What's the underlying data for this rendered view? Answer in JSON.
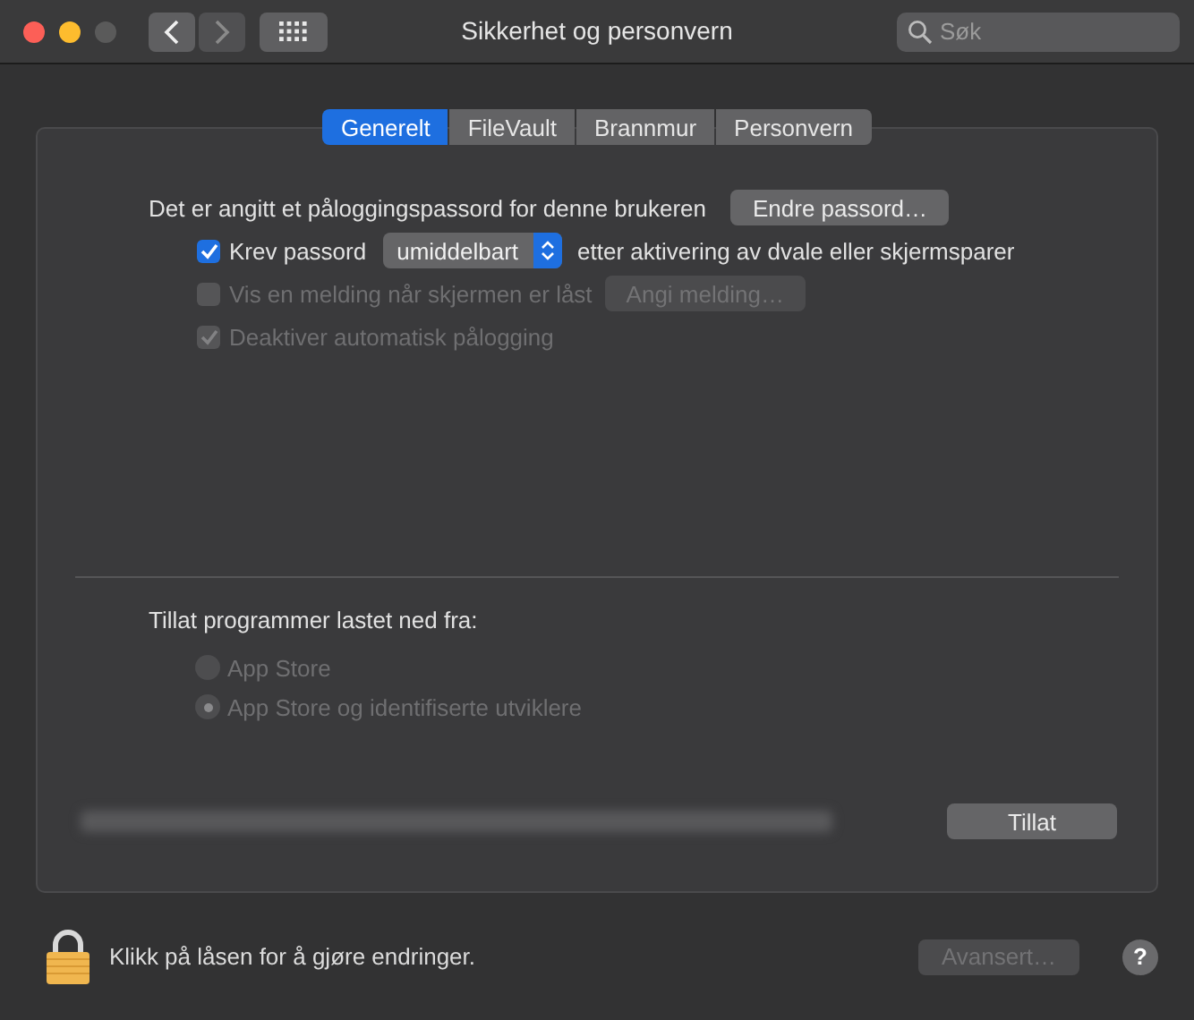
{
  "window": {
    "title": "Sikkerhet og personvern",
    "back_disabled": false,
    "forward_disabled": true,
    "search": {
      "placeholder": "Søk"
    }
  },
  "tabs": [
    {
      "label": "Generelt",
      "selected": true
    },
    {
      "label": "FileVault",
      "selected": false
    },
    {
      "label": "Brannmur",
      "selected": false
    },
    {
      "label": "Personvern",
      "selected": false
    }
  ],
  "general": {
    "password_text": "Det er angitt et påloggingspassord for denne brukeren",
    "change_password_button": "Endre passord…",
    "options": [
      {
        "kind": "require",
        "label": "Krev passord",
        "checked": true,
        "disabled": false,
        "select_value": "umiddelbart",
        "suffix": "etter aktivering av dvale eller skjermsparer"
      },
      {
        "kind": "message",
        "label": "Vis en melding når skjermen er låst",
        "checked": false,
        "disabled": true,
        "button": "Angi melding…"
      },
      {
        "kind": "plain",
        "label": "Deaktiver automatisk pålogging",
        "checked": true,
        "disabled": true
      }
    ]
  },
  "downloads": {
    "heading": "Tillat programmer lastet ned fra:",
    "sources": [
      {
        "label": "App Store",
        "selected": false,
        "disabled": true
      },
      {
        "label": "App Store og identifiserte utviklere",
        "selected": true,
        "disabled": true
      }
    ],
    "allow_button": "Tillat"
  },
  "footer": {
    "lock_text": "Klikk på låsen for å gjøre endringer.",
    "advanced_button": "Avansert…",
    "advanced_disabled": true,
    "help": "?"
  }
}
